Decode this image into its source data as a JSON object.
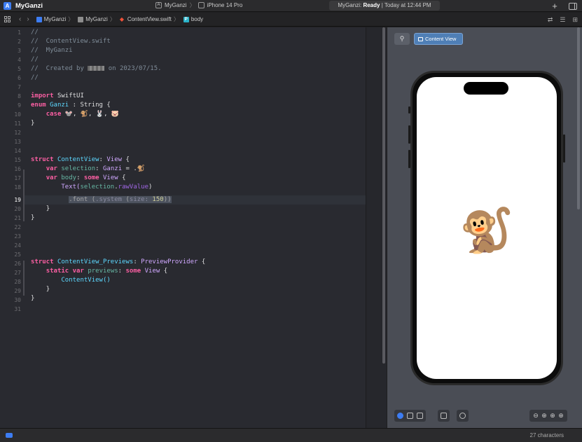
{
  "window": {
    "app_title": "MyGanzi",
    "scheme": "MyGanzi",
    "destination": "iPhone 14 Pro",
    "status_app": "MyGanzi:",
    "status_state": "Ready",
    "status_time": "| Today at 12:44 PM"
  },
  "jumpbar": {
    "crumbs": [
      "MyGanzi",
      "MyGanzi",
      "ContentView.swift",
      "body"
    ]
  },
  "editor": {
    "line_numbers": [
      "1",
      "2",
      "3",
      "4",
      "5",
      "6",
      "7",
      "8",
      "9",
      "10",
      "11",
      "12",
      "13",
      "14",
      "15",
      "16",
      "17",
      "18",
      "19",
      "20",
      "21",
      "22",
      "23",
      "24",
      "25",
      "26",
      "27",
      "28",
      "29",
      "30",
      "31"
    ],
    "current_line": 19,
    "comments": {
      "l1": "//",
      "l2": "//  ContentView.swift",
      "l3": "//  MyGanzi",
      "l4": "//",
      "l5_a": "//  Created by ",
      "l5_b": " on 2023/07/15.",
      "l6": "//"
    },
    "import_kw": "import",
    "import_mod": "SwiftUI",
    "enum_kw": "enum",
    "enum_name": "Ganzi",
    "enum_rest": " : String {",
    "case_kw": "case",
    "case_values": "🐭, 🐒, 🐰, 🐷",
    "brace": "}",
    "struct_kw": "struct",
    "cv_name": "ContentView",
    "cv_proto": "View",
    "var_kw": "var",
    "selection": "selection",
    "sel_type": "Ganzi",
    "sel_default": " = .🐒",
    "body": "body",
    "some_kw": "some",
    "text_call": "Text(",
    "raw_value": "rawValue",
    "font_mod": ".font",
    "font_paren": " (",
    "system": ".system",
    "size_label": "size:",
    "size_value": "150",
    "font_close": "))",
    "preview_name": "ContentView_Previews",
    "preview_proto": "PreviewProvider",
    "static_kw": "static",
    "previews": "previews",
    "cv_call": "ContentView()"
  },
  "canvas": {
    "pin_icon": "pin-icon",
    "content_view_label": "Content View",
    "preview_emoji": "🐒",
    "zoom_controls": [
      "⊖",
      "⊕",
      "⊕",
      "⊕"
    ]
  },
  "statusbar": {
    "characters": "27 characters"
  }
}
